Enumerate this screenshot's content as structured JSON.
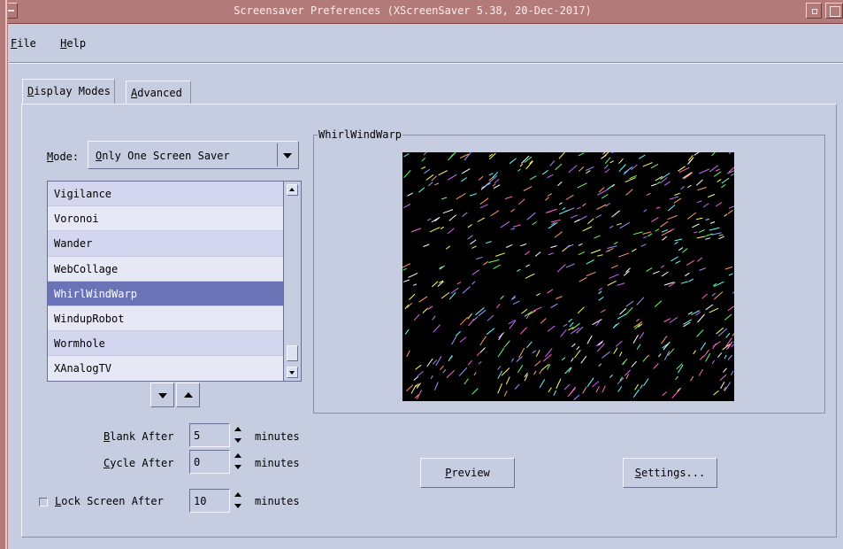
{
  "window": {
    "title": "Screensaver Preferences  (XScreenSaver 5.38, 20-Dec-2017)"
  },
  "menubar": {
    "items": [
      {
        "mnemonic": "F",
        "rest": "ile"
      },
      {
        "mnemonic": "H",
        "rest": "elp"
      }
    ]
  },
  "tabs": [
    {
      "mnemonic": "D",
      "rest": "isplay Modes",
      "active": true
    },
    {
      "mnemonic": "A",
      "rest": "dvanced",
      "active": false
    }
  ],
  "mode": {
    "label_mnemonic": "M",
    "label_rest": "ode:",
    "value_mnemonic": "O",
    "value_rest": "nly One Screen Saver"
  },
  "saver_list": {
    "items": [
      {
        "label": "Vigilance"
      },
      {
        "label": "Voronoi"
      },
      {
        "label": "Wander"
      },
      {
        "label": "WebCollage"
      },
      {
        "label": "WhirlWindWarp",
        "selected": true
      },
      {
        "label": "WindupRobot"
      },
      {
        "label": "Wormhole"
      },
      {
        "label": "XAnalogTV"
      }
    ]
  },
  "timing": {
    "blank_mnemonic": "B",
    "blank_rest": "lank After",
    "blank_value": "5",
    "cycle_mnemonic": "C",
    "cycle_rest": "ycle After",
    "cycle_value": "0",
    "lock_mnemonic": "L",
    "lock_rest": "ock Screen After",
    "lock_value": "10",
    "lock_checked": false,
    "unit": "minutes"
  },
  "preview_group": {
    "title": "WhirlWindWarp"
  },
  "buttons": {
    "preview_mnemonic": "P",
    "preview_rest": "review",
    "settings_mnemonic": "S",
    "settings_rest": "ettings..."
  },
  "colors": {
    "window_bg": "#c7cde0",
    "titlebar": "#b37a7a",
    "selection": "#6a73b6",
    "preview_bg": "#000000"
  }
}
